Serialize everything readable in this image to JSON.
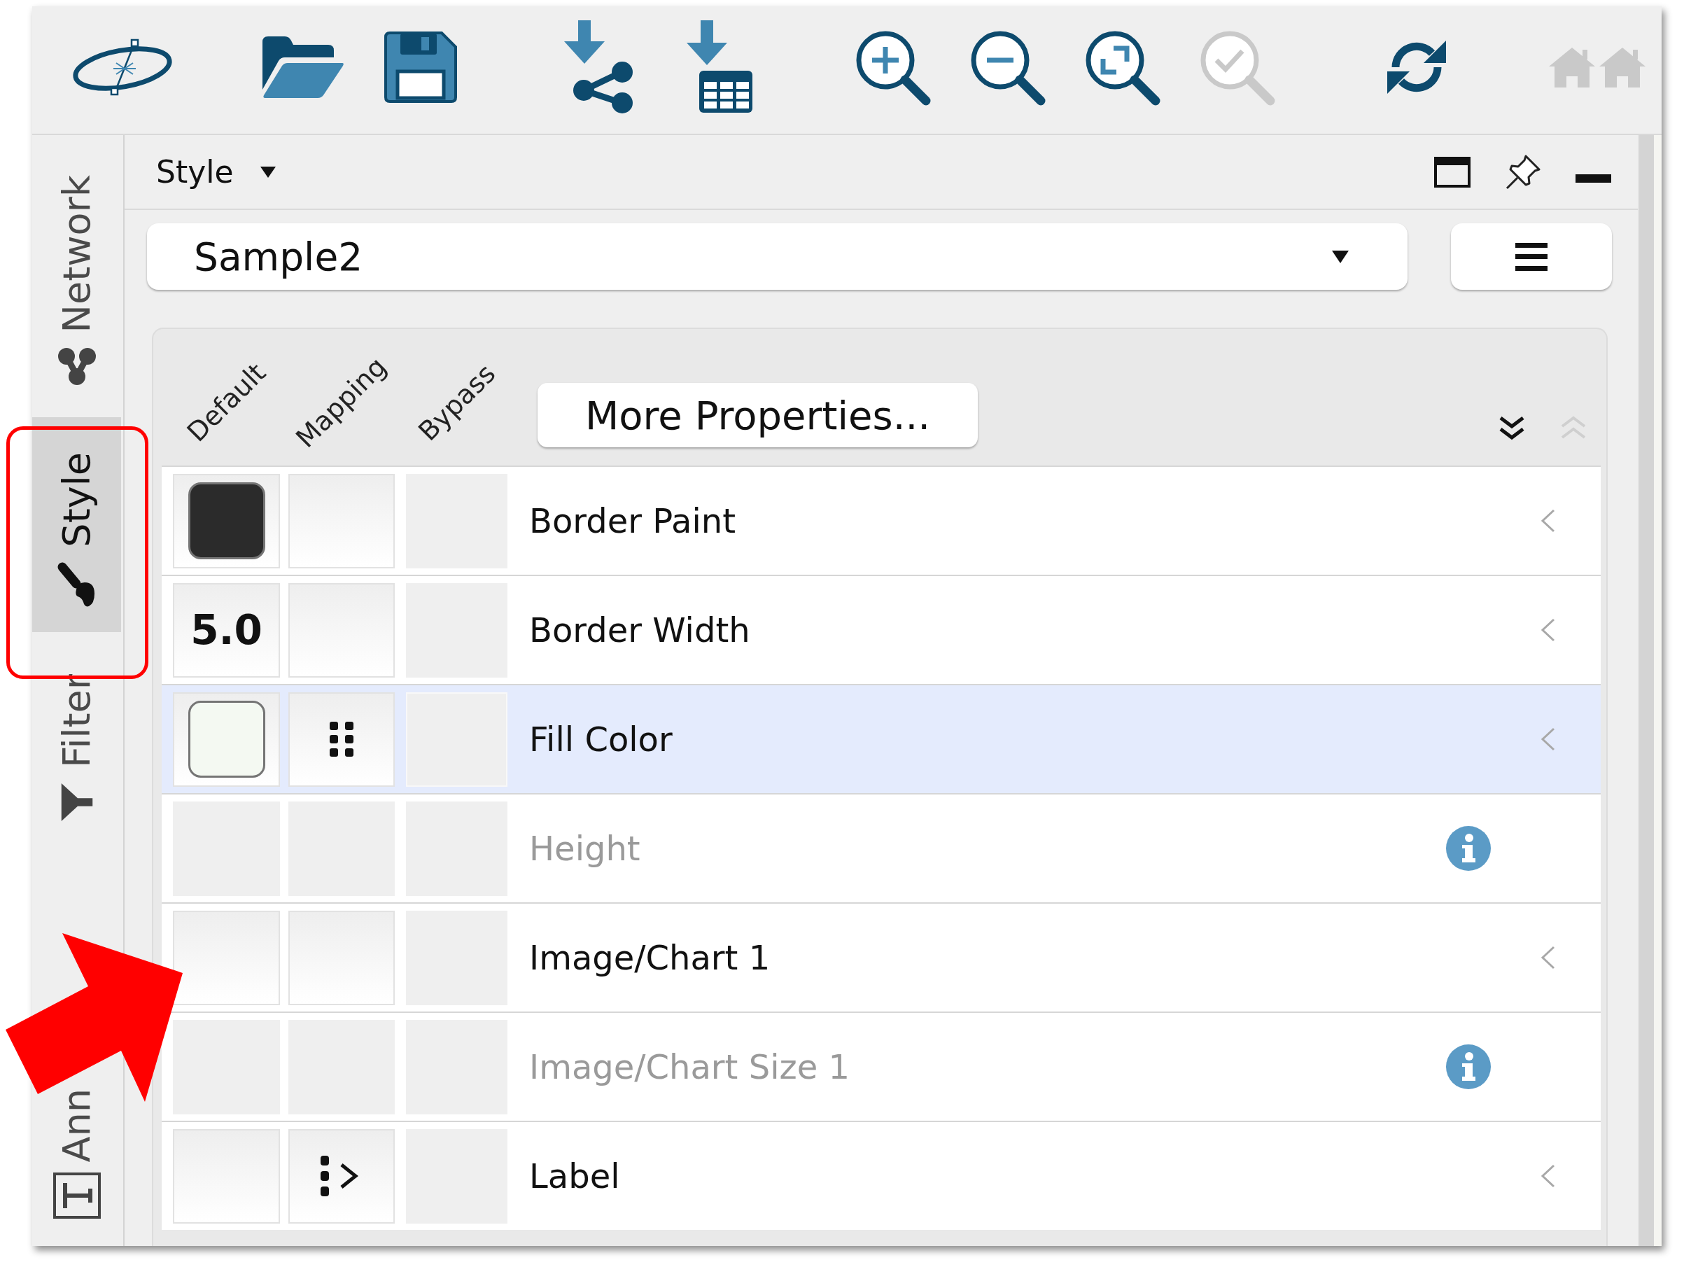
{
  "toolbar": {
    "buttons": [
      {
        "kind": "logo",
        "disabled": false
      },
      {
        "kind": "open",
        "disabled": false
      },
      {
        "kind": "save",
        "disabled": false
      },
      {
        "kind": "importnetwork",
        "disabled": false
      },
      {
        "kind": "importtable",
        "disabled": false
      },
      {
        "kind": "zoomin",
        "disabled": false
      },
      {
        "kind": "zoomout",
        "disabled": false
      },
      {
        "kind": "zoomfit",
        "disabled": false
      },
      {
        "kind": "zoomselected",
        "disabled": true
      },
      {
        "kind": "refresh",
        "disabled": false
      },
      {
        "kind": "home",
        "disabled": true
      }
    ]
  },
  "side_tabs": [
    {
      "label": "Network",
      "kind": "network",
      "selected": false
    },
    {
      "label": "Style",
      "kind": "style",
      "selected": true
    },
    {
      "label": "Filter",
      "kind": "filter",
      "selected": false
    },
    {
      "label": "Ann",
      "kind": "annotation",
      "selected": false
    }
  ],
  "panel": {
    "title": "Style",
    "style_selector": {
      "value": "Sample2"
    },
    "column_headers": [
      "Default",
      "Mapping",
      "Bypass"
    ],
    "more_button": "More Properties...",
    "expand_buttons": [
      {
        "kind": "expand",
        "disabled": false
      },
      {
        "kind": "collapse",
        "disabled": true
      }
    ],
    "properties": [
      {
        "label": "Border Paint",
        "selected": false,
        "disabled": false,
        "default": {
          "kind": "swatch",
          "color": "#2b2b2b"
        }
      },
      {
        "label": "Border Width",
        "selected": false,
        "disabled": false,
        "default": {
          "kind": "number",
          "value": "5.0"
        }
      },
      {
        "label": "Fill Color",
        "selected": true,
        "disabled": false,
        "default": {
          "kind": "swatch",
          "color": "#f4f9f2"
        },
        "mapping": {
          "kind": "continuous"
        }
      },
      {
        "label": "Height",
        "selected": false,
        "disabled": true
      },
      {
        "label": "Image/Chart 1",
        "selected": false,
        "disabled": false
      },
      {
        "label": "Image/Chart Size 1",
        "selected": false,
        "disabled": true
      },
      {
        "label": "Label",
        "selected": false,
        "disabled": false,
        "mapping": {
          "kind": "passthrough"
        }
      }
    ]
  }
}
